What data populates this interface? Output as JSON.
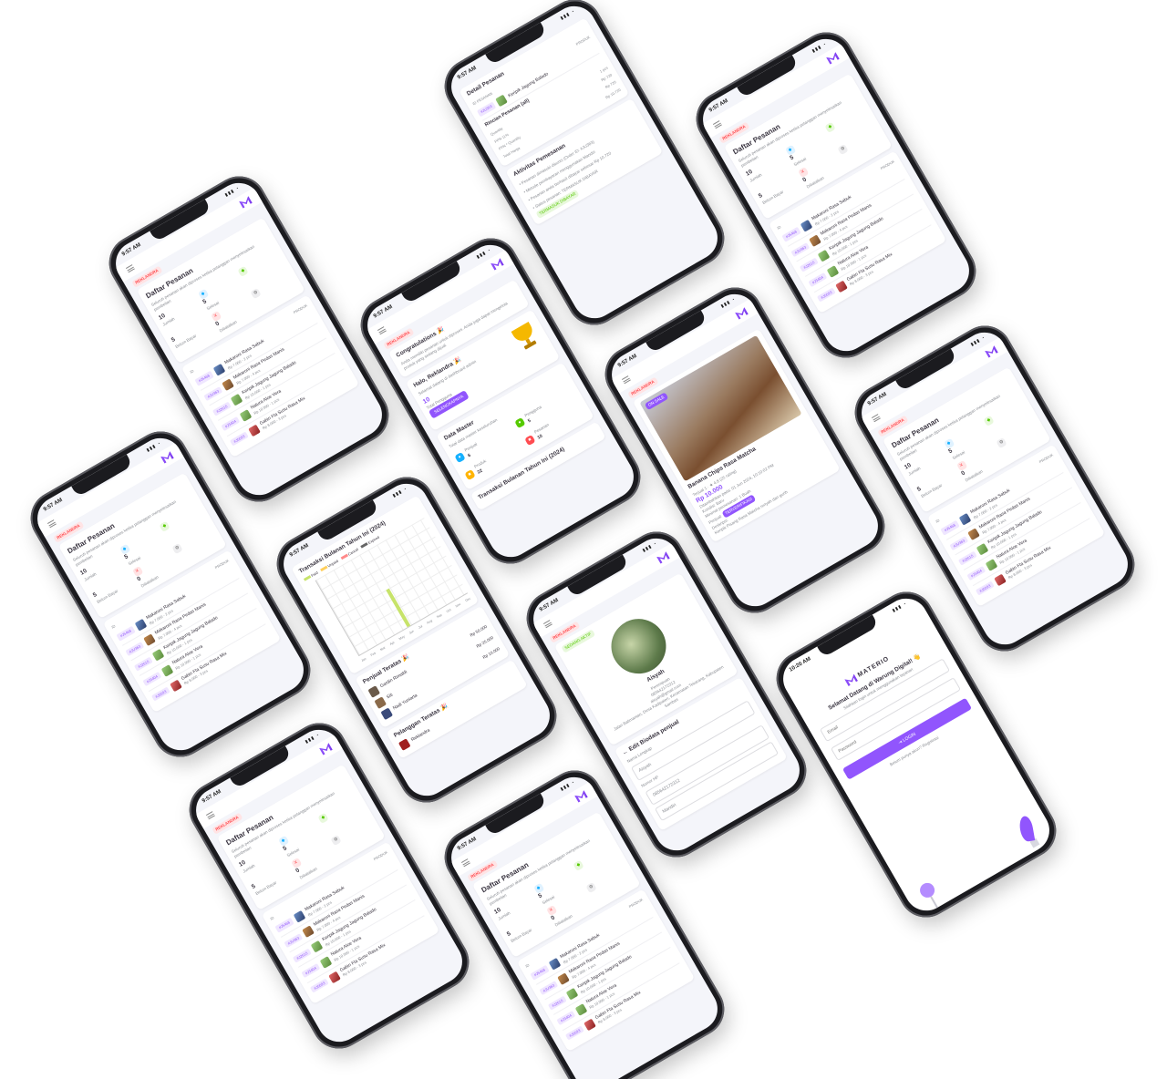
{
  "status": {
    "time": "9:57 AM",
    "time_login": "10:20 AM"
  },
  "brand": {
    "name": "MATERIO",
    "accent": "#9155fd",
    "danger": "#ff4c51",
    "success": "#56ca00",
    "info": "#16b1ff"
  },
  "role_badge": "REKLANDRA",
  "orders": {
    "title": "Daftar Pesanan",
    "subtitle": "Seluruh pesanan akan diproses ketika pelanggan menyelesaikan pembelian",
    "stats": [
      {
        "value": "10",
        "label": "Jumlah"
      },
      {
        "value": "5",
        "label": "Selesai"
      },
      {
        "value": "5",
        "label": "Belum Bayar"
      },
      {
        "value": "0",
        "label": "Dibatalkan"
      }
    ],
    "table_head": {
      "id": "ID",
      "product": "PRODUK"
    },
    "rows": [
      {
        "id": "#J5468",
        "name": "Makaroni Rasa Sabuk",
        "meta": "Rp 7.000 - 2 pcs"
      },
      {
        "id": "#JU363",
        "name": "Makaroni Rasa Pedas Manis",
        "meta": "Rp 7.000 - 4 pcs"
      },
      {
        "id": "#J2615",
        "name": "Keripik Jagung Jagung Balado",
        "meta": "Rp 10.000 - 1 pcs"
      },
      {
        "id": "#J3404",
        "name": "Natura Aloe Vera",
        "meta": "Rp 10.000 - 1 pcs"
      },
      {
        "id": "#J5693",
        "name": "Gabin Fla Susu Rasa Mix",
        "meta": "Rp 8.000 - 3 pcs"
      }
    ]
  },
  "order_detail": {
    "title": "Detail Pesanan",
    "col_id": "ID PESANAN",
    "col_product": "PRODUK",
    "product": "Keripik Jagung Balado",
    "order_id": "#JU363",
    "summary_title": "Rincian Pesanan (all)",
    "summary": [
      {
        "k": "Quantity",
        "v": "1 pcs"
      },
      {
        "k": "PPN 11%",
        "v": "Rp 720"
      },
      {
        "k": "PPN * Quantity",
        "v": "Rp 720"
      },
      {
        "k": "Total Harga",
        "v": "Rp 10.720"
      }
    ],
    "activity_title": "Aktivitas Pemesanan",
    "activity": [
      "Pesanan dimasuki dikunci (Order ID: #JU363)",
      "Metode pembayaran menggunakan Mandiri",
      "Pesanan anda berhasil dibayar sebesar Rp 10.720",
      "Status pesanan: TERMASUK DIBAYAR"
    ],
    "status_badge": "TERMASUK DIBAYAR"
  },
  "dashboard": {
    "congrats_title": "Congratulations 🎉",
    "congrats_text": "Anda memiliki pesanan untuk diproses. Anda juga dapat mengelola produk yang sedang dijual.",
    "hello": "Halo, Reklandra 🎉",
    "hello_sub": "Selamat datang di dashboard admin",
    "hello_count": "10",
    "hello_count_label": "Total Pengguna",
    "hello_button": "SELENGKAPNYA",
    "master_title": "Data Master",
    "master_sub": "Total data master keseluruhan",
    "master": [
      {
        "value": "6",
        "label": "Penjual"
      },
      {
        "value": "22",
        "label": "Produk"
      },
      {
        "value": "5",
        "label": "Pengguna"
      },
      {
        "value": "10",
        "label": "Pesanan"
      }
    ],
    "trx_title": "Transaksi Bulanan Tahun Ini (2024)"
  },
  "chart_screen": {
    "title": "Transaksi Bulanan Tahun Ini (2024)",
    "legend": [
      "Paid",
      "Unpaid",
      "Cancel",
      "Expired"
    ],
    "sellers_title": "Penjual Teratas 🎉",
    "sellers": [
      {
        "name": "Gardin Rimaldi",
        "amount": "Rp 50.000"
      },
      {
        "name": "Siti",
        "amount": "Rp 25.000"
      },
      {
        "name": "Nadi Yuniarta",
        "amount": "Rp 10.000"
      }
    ],
    "buyers_title": "Pelanggan Teratas 🎉",
    "buyers": [
      {
        "name": "Reklandra"
      }
    ]
  },
  "chart_data": {
    "type": "bar",
    "title": "Transaksi Bulanan Tahun Ini (2024)",
    "categories": [
      "Jan",
      "Feb",
      "Mar",
      "Apr",
      "May",
      "Jun",
      "Jul",
      "Aug",
      "Sep",
      "Oct",
      "Nov",
      "Dec"
    ],
    "series": [
      {
        "name": "Paid",
        "values": [
          0,
          0,
          0,
          0,
          0,
          5,
          0,
          0,
          0,
          0,
          0,
          0
        ]
      }
    ],
    "ylim": [
      0,
      10
    ]
  },
  "product": {
    "tag": "ON SALE",
    "name": "Banana Chips Rasa Matcha",
    "sold": "Terjual 1",
    "rating": "4.8 (25 rating)",
    "price": "Rp 10.000",
    "posted": "Ditambahkan pada: 01 Jun 2024, 10:10:02 PM",
    "condition": "Kondisi: Baru",
    "min_order": "Minimal pemesanan: 1 Buah",
    "seller_label": "Penjual:",
    "seller": "TERVERIFIKASI",
    "desc_label": "Deskripsi:",
    "desc": "Keripik Pisang Rasa Matcha renyah dan gurih"
  },
  "profile": {
    "badge": "SEDANG AKTIF",
    "name": "Aisyah",
    "gender": "Perempuan",
    "phone": "085642172312",
    "email": "aisyah@gmail.com",
    "address": "Jalan Balimantan, Desa Kadipaten, Kecamatan Tekarang, Kabupaten Sambas",
    "edit_title": "Edit Biodata penjual",
    "field_name_label": "Nama Lengkap",
    "field_name_value": "Aisyah",
    "field_phone_label": "Nomor HP",
    "field_phone_value": "085642172312",
    "field_bank": "Mandiri"
  },
  "login": {
    "welcome": "Selamat Datang di Warung Digital! 👋",
    "sub": "Silahkan login untuk menggunakan layanan",
    "email_placeholder": "Email",
    "password_placeholder": "Password",
    "button": "LOGIN",
    "register": "Belum punya akun? Registrasi"
  }
}
